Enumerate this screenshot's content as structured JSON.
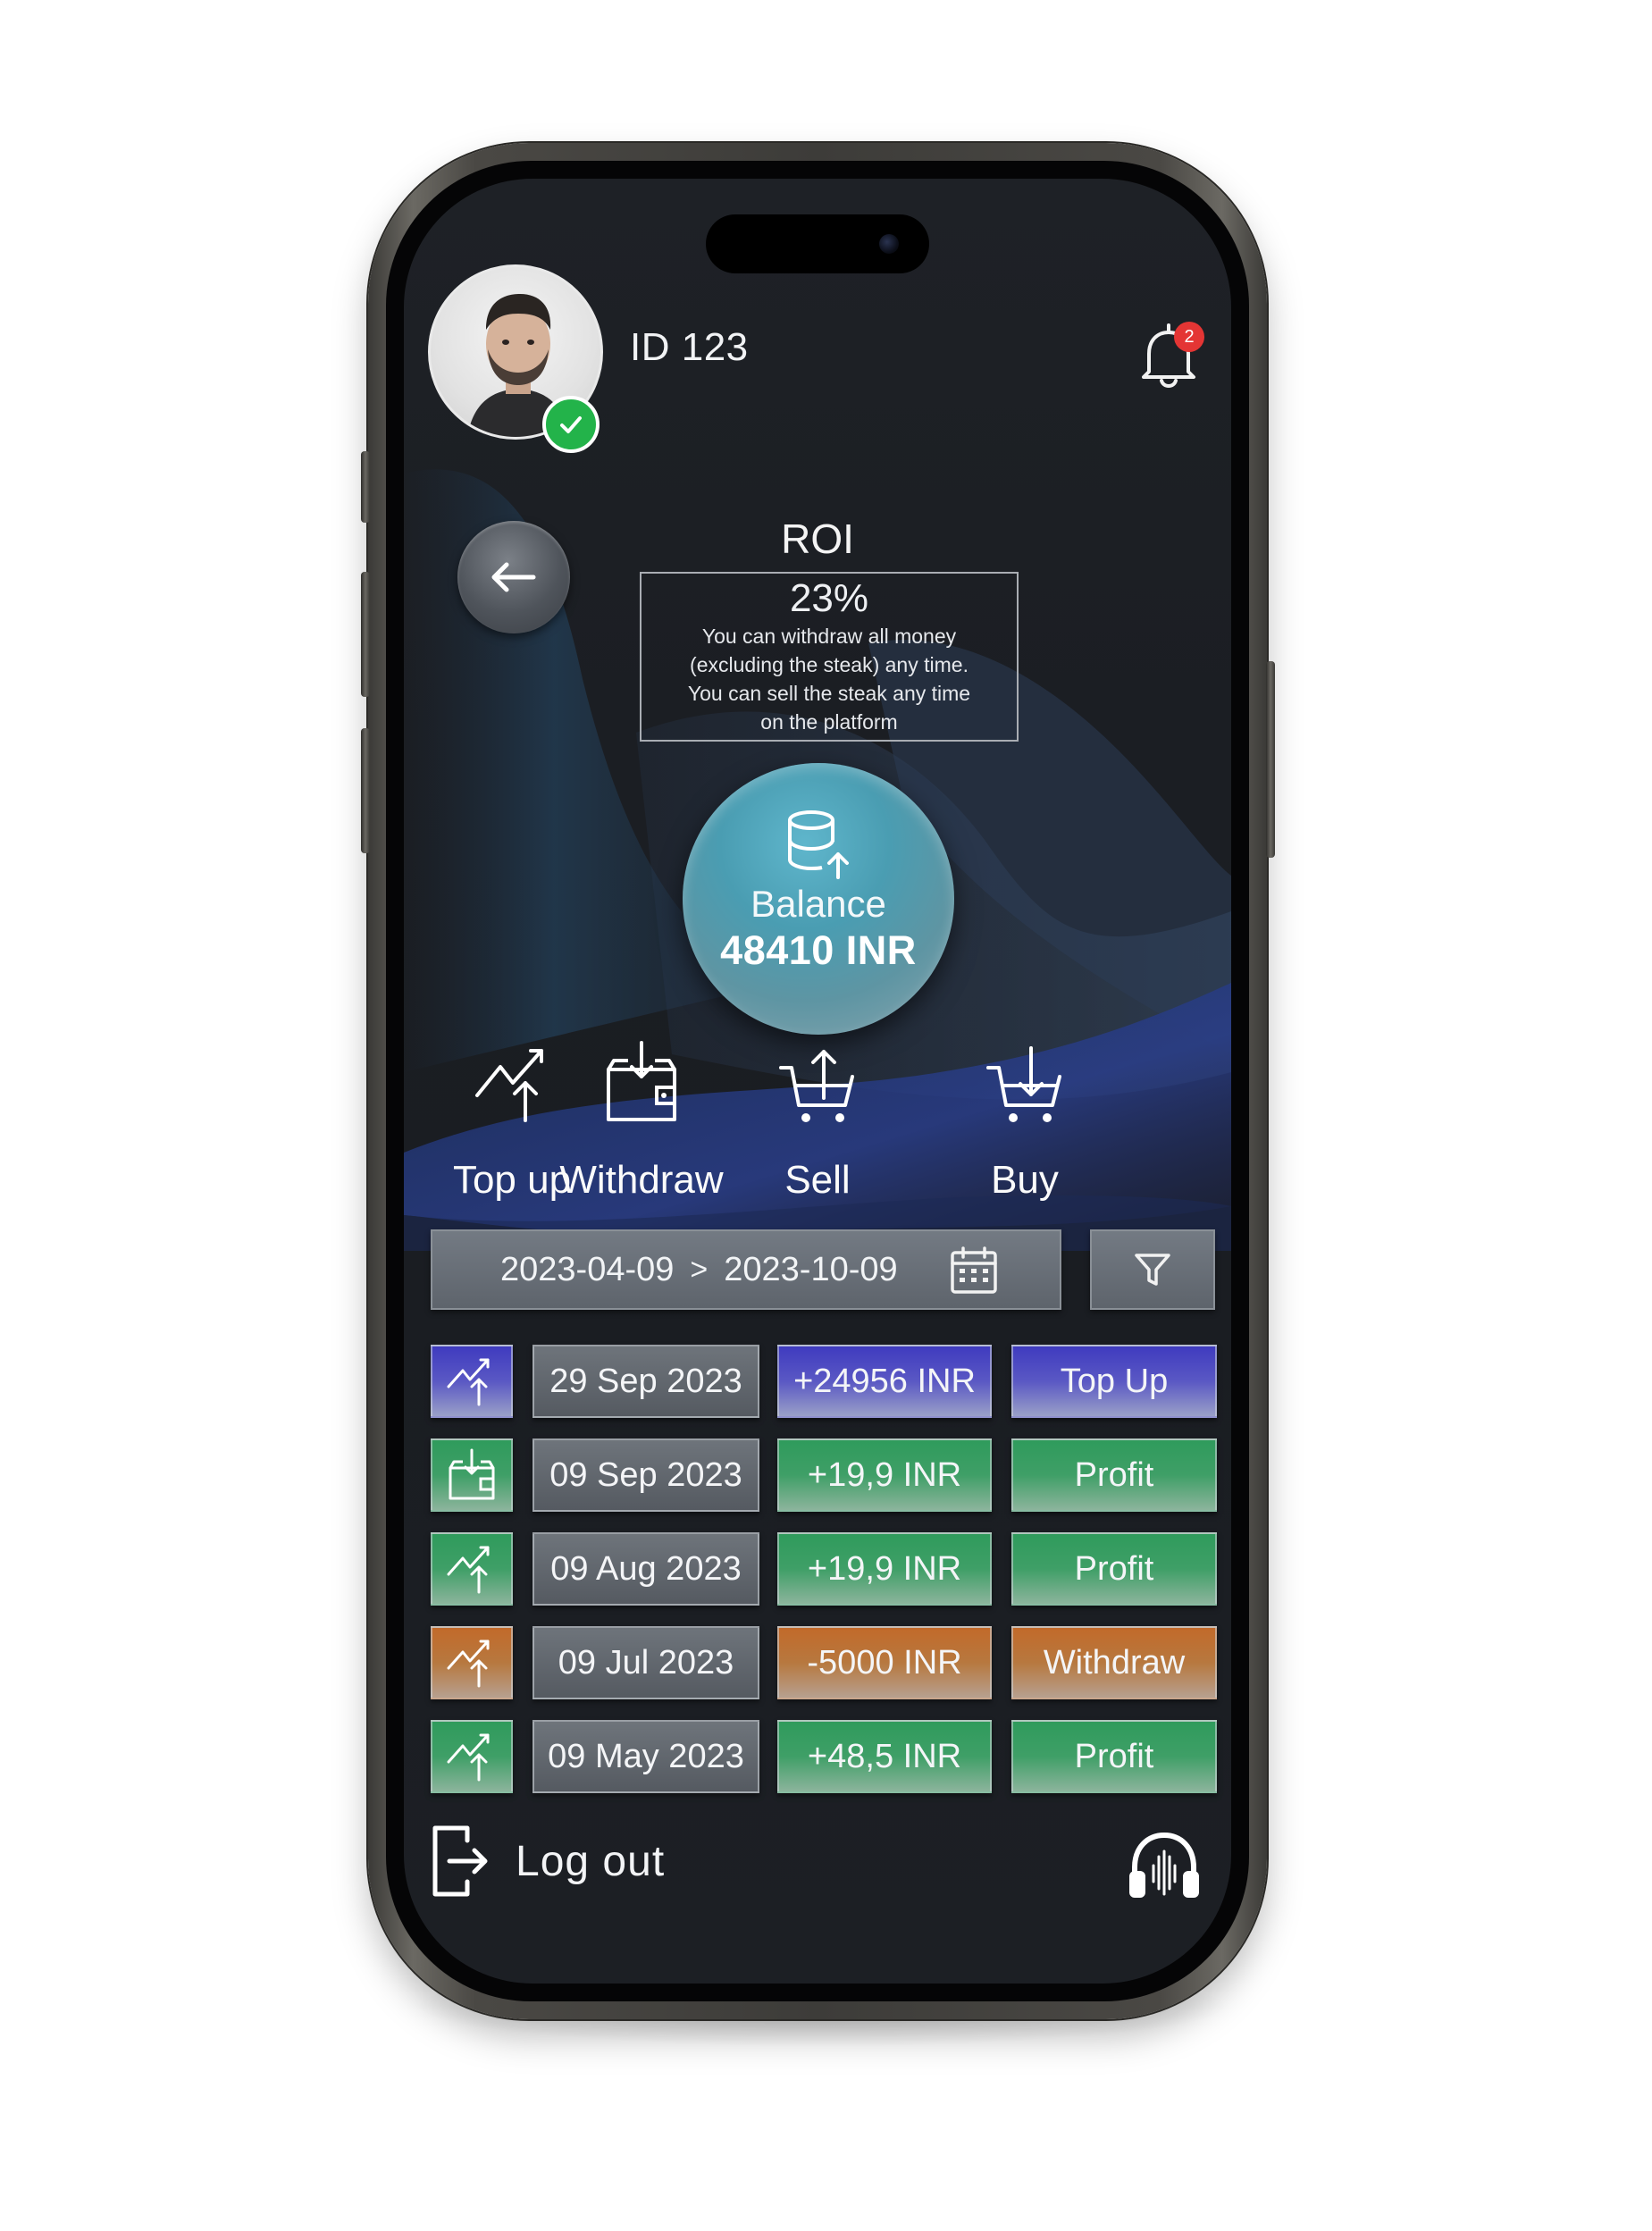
{
  "header": {
    "user_id": "ID 123",
    "notification_count": "2"
  },
  "roi": {
    "title": "ROI",
    "percent": "23%",
    "note_lines": [
      "You can withdraw all money",
      "(excluding the steak) any time.",
      "You can sell the steak any time",
      "on the platform"
    ]
  },
  "balance": {
    "label": "Balance",
    "value": "48410 INR",
    "icon": "database-upload-icon"
  },
  "actions": [
    {
      "label": "Top up",
      "icon": "trend-up-icon"
    },
    {
      "label": "Withdraw",
      "icon": "wallet-download-icon"
    },
    {
      "label": "Sell",
      "icon": "cart-upload-icon"
    },
    {
      "label": "Buy",
      "icon": "cart-download-icon"
    }
  ],
  "date_filter": {
    "from": "2023-04-09",
    "separator": ">",
    "to": "2023-10-09"
  },
  "transactions": [
    {
      "icon": "trend-up-icon",
      "date": "29 Sep 2023",
      "amount": "+24956 INR",
      "type": "Top Up",
      "color": "#3f3bbf"
    },
    {
      "icon": "wallet-download-icon",
      "date": "09 Sep 2023",
      "amount": "+19,9 INR",
      "type": "Profit",
      "color": "#2f9b5c"
    },
    {
      "icon": "trend-up-icon",
      "date": "09 Aug 2023",
      "amount": "+19,9 INR",
      "type": "Profit",
      "color": "#2f9b5c"
    },
    {
      "icon": "trend-up-icon",
      "date": "09 Jul 2023",
      "amount": "-5000 INR",
      "type": "Withdraw",
      "color": "#c26a2a"
    },
    {
      "icon": "trend-up-icon",
      "date": "09 May 2023",
      "amount": "+48,5 INR",
      "type": "Profit",
      "color": "#2f9b5c"
    }
  ],
  "footer": {
    "logout_label": "Log out"
  },
  "colors": {
    "background": "#1b1e23",
    "top_up": "#3f3bbf",
    "profit": "#2f9b5c",
    "withdraw": "#c26a2a",
    "balance_accent": "#4a9db2",
    "verified": "#23b34a",
    "badge": "#e43534"
  }
}
